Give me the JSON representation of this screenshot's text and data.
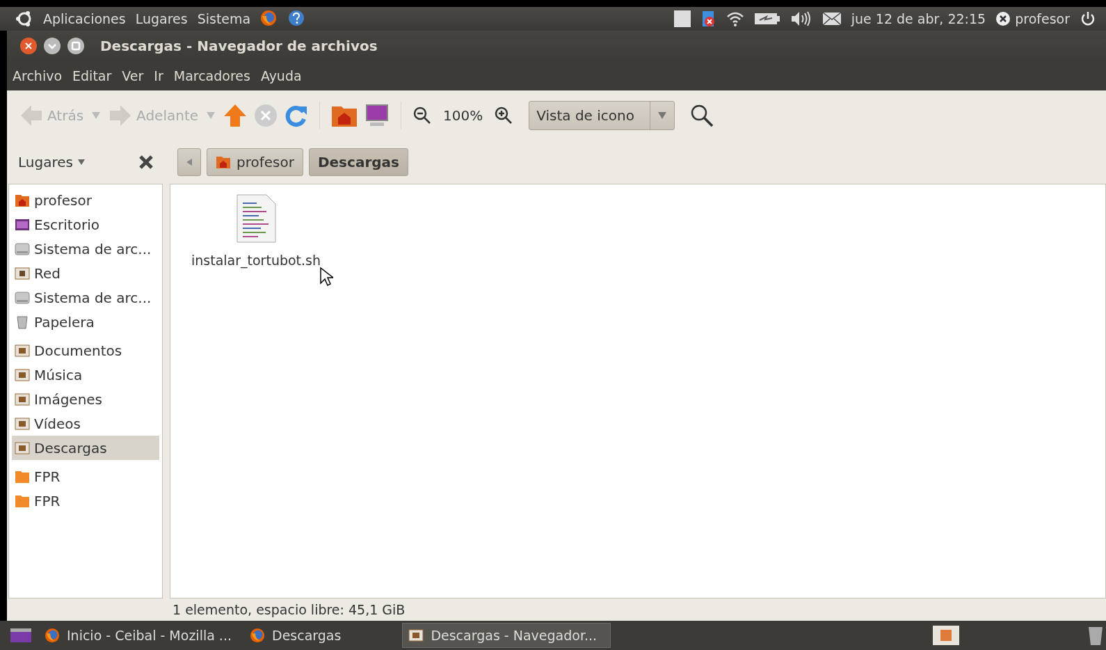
{
  "top_panel": {
    "menus": [
      "Aplicaciones",
      "Lugares",
      "Sistema"
    ],
    "clock": "jue 12 de abr, 22:15",
    "user": "profesor"
  },
  "window": {
    "title": "Descargas - Navegador de archivos",
    "menu": [
      "Archivo",
      "Editar",
      "Ver",
      "Ir",
      "Marcadores",
      "Ayuda"
    ]
  },
  "toolbar": {
    "back": {
      "label": "Atrás",
      "disabled": true
    },
    "forward": {
      "label": "Adelante",
      "disabled": true
    },
    "zoom": "100%",
    "view": "Vista de icono"
  },
  "sidebar": {
    "title": "Lugares",
    "sections": [
      {
        "items": [
          {
            "label": "profesor",
            "kind": "home",
            "selected": false
          },
          {
            "label": "Escritorio",
            "kind": "desktop",
            "selected": false
          },
          {
            "label": "Sistema de arc...",
            "kind": "drive",
            "selected": false
          },
          {
            "label": "Red",
            "kind": "network",
            "selected": false
          },
          {
            "label": "Sistema de arc...",
            "kind": "drive",
            "selected": false
          },
          {
            "label": "Papelera",
            "kind": "trash",
            "selected": false
          }
        ]
      },
      {
        "items": [
          {
            "label": "Documentos",
            "kind": "folder",
            "selected": false
          },
          {
            "label": "Música",
            "kind": "folder",
            "selected": false
          },
          {
            "label": "Imágenes",
            "kind": "folder",
            "selected": false
          },
          {
            "label": "Vídeos",
            "kind": "folder",
            "selected": false
          },
          {
            "label": "Descargas",
            "kind": "folder",
            "selected": true
          }
        ]
      },
      {
        "items": [
          {
            "label": "FPR",
            "kind": "bookmark",
            "selected": false
          },
          {
            "label": "FPR",
            "kind": "bookmark",
            "selected": false
          }
        ]
      }
    ]
  },
  "path_bar": [
    {
      "label": "profesor",
      "selected": false
    },
    {
      "label": "Descargas",
      "selected": true
    }
  ],
  "files": [
    {
      "name": "instalar_tortubot.sh"
    }
  ],
  "status_bar": "1 elemento, espacio libre: 45,1 GiB",
  "taskbar": [
    {
      "label": "Inicio - Ceibal - Mozilla ...",
      "selected": false
    },
    {
      "label": "Descargas",
      "selected": false
    },
    {
      "label": "Descargas - Navegador...",
      "selected": true
    }
  ]
}
